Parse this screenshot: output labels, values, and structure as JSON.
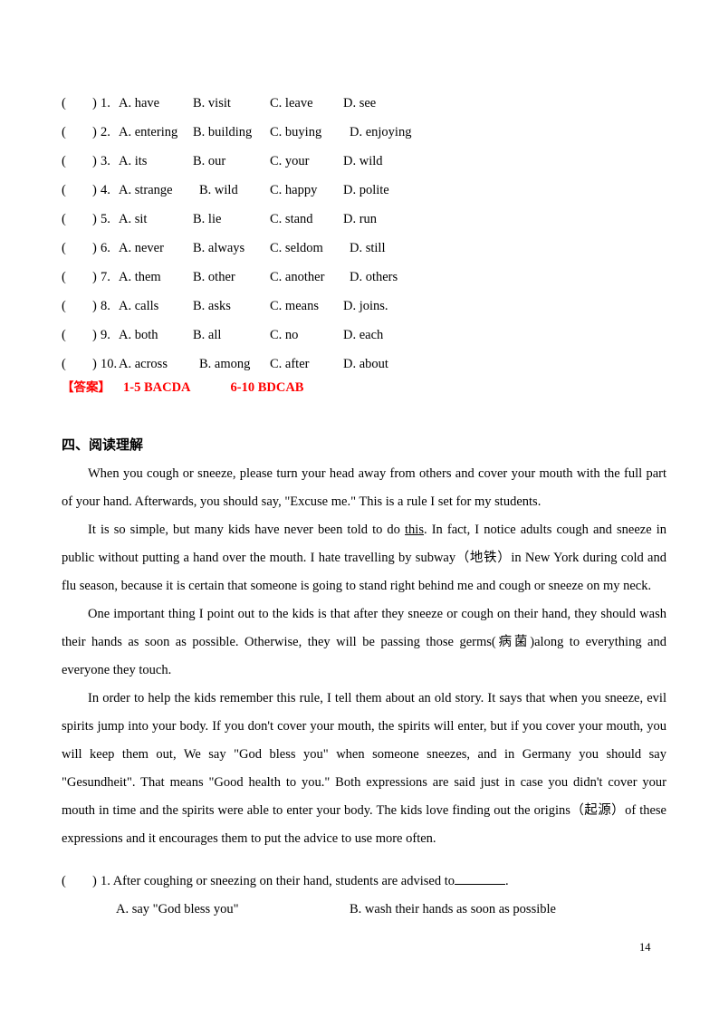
{
  "cloze": {
    "rows": [
      {
        "paren_open": "(",
        "paren_close": ")",
        "number": "1.",
        "a": "A. have",
        "b": "B. visit",
        "c": "C. leave",
        "d": "D. see"
      },
      {
        "paren_open": "(",
        "paren_close": ")",
        "number": "2.",
        "a": "A. entering",
        "b": "B. building",
        "c": "C. buying",
        "d": "D. enjoying"
      },
      {
        "paren_open": "(",
        "paren_close": ")",
        "number": "3.",
        "a": "A. its",
        "b": "B. our",
        "c": "C. your",
        "d": "D. wild"
      },
      {
        "paren_open": "(",
        "paren_close": ")",
        "number": "4.",
        "a": "A. strange",
        "b": "B. wild",
        "c": "C. happy",
        "d": "D. polite"
      },
      {
        "paren_open": "(",
        "paren_close": ")",
        "number": "5.",
        "a": "A. sit",
        "b": "B. lie",
        "c": "C. stand",
        "d": "D. run"
      },
      {
        "paren_open": "(",
        "paren_close": ")",
        "number": "6.",
        "a": "A. never",
        "b": "B. always",
        "c": "C. seldom",
        "d": "D. still"
      },
      {
        "paren_open": "(",
        "paren_close": ")",
        "number": "7.",
        "a": "A. them",
        "b": "B. other",
        "c": "C. another",
        "d": "D. others"
      },
      {
        "paren_open": "(",
        "paren_close": ")",
        "number": "8.",
        "a": "A. calls",
        "b": "B. asks",
        "c": "C. means",
        "d": "D. joins."
      },
      {
        "paren_open": "(",
        "paren_close": ")",
        "number": "9.",
        "a": "A. both",
        "b": "B. all",
        "c": "C. no",
        "d": "D. each"
      },
      {
        "paren_open": "(",
        "paren_close": ")",
        "number": "10.",
        "a": "A. across",
        "b": "B. among",
        "c": "C. after",
        "d": "D. about"
      }
    ]
  },
  "answer_key": {
    "label": "【答案】",
    "range1": "1-5 BACDA",
    "range2": "6-10 BDCAB",
    "color": "#FF0000"
  },
  "section": {
    "heading": "四、阅读理解"
  },
  "passage": {
    "paragraphs": [
      "When you cough or sneeze, please turn your head away from others and cover your mouth with the full part of your hand. Afterwards, you should say, \"Excuse me.\" This is a rule I set for my students.",
      "It is so simple, but many kids have never been told to do ",
      "One important thing I point out to the kids is that after they sneeze or cough on their hand, they should wash their hands as soon as possible. Otherwise, they will be passing those germs(病菌)along to everything and everyone they touch.",
      "In order to help the kids remember this rule, I tell them about an old story. It says that when you sneeze, evil spirits jump into your body. If you don't cover your mouth, the spirits will enter, but if you cover your mouth, you will keep them out, We say \"God bless you\" when someone sneezes, and in Germany you should say \"Gesundheit\". That means \"Good health to you.\" Both expressions are said just in case you didn't cover your mouth in time and the spirits were able to enter your body. The kids love finding out the origins（起源）of these expressions and it encourages them to put the advice to use more often."
    ],
    "para2_before": "It is so simple, but many kids have never been told to do ",
    "para2_underlined": "this",
    "para2_after": ". In fact, I notice adults cough and sneeze in public without putting a hand over the mouth. I hate travelling by subway（地铁）in New York during cold and flu season, because it is certain that someone is going to stand right behind me and cough or sneeze on my neck."
  },
  "reading_question": {
    "paren_open": "(",
    "paren_close": ")",
    "number_and_stem_before": "1. After coughing or sneezing on their hand, students are advised to",
    "stem_after": ".",
    "choice_a": "A. say \"God bless you\"",
    "choice_b": "B. wash their hands as soon as possible"
  },
  "footer": {
    "page_number": "14"
  }
}
